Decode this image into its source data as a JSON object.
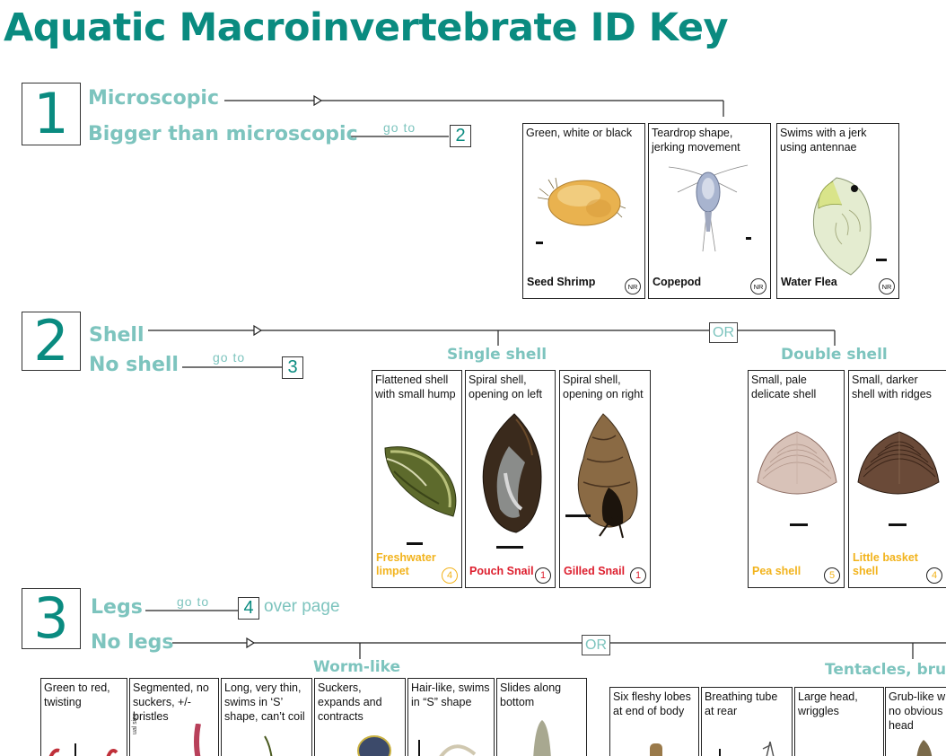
{
  "title": "Aquatic Macroinvertebrate ID Key",
  "steps": {
    "s1": {
      "number": "1",
      "opt_a": "Microscopic",
      "opt_b": "Bigger than microscopic",
      "goto_text": "go to",
      "goto_num": "2"
    },
    "s2": {
      "number": "2",
      "opt_a": "Shell",
      "opt_b": "No shell",
      "goto_text": "go to",
      "goto_num": "3",
      "or_label": "OR",
      "group_a": "Single shell",
      "group_b": "Double shell"
    },
    "s3": {
      "number": "3",
      "opt_a": "Legs",
      "opt_b": "No legs",
      "goto_text": "go to",
      "goto_num": "4",
      "over_page": "over page",
      "or_label": "OR",
      "group_a": "Worm-like",
      "group_b": "Tentacles, brus"
    }
  },
  "cards": {
    "seed_shrimp": {
      "desc": "Green, white or black",
      "name": "Seed Shrimp",
      "badge": "NR"
    },
    "copepod": {
      "desc": "Teardrop shape, jerking movement",
      "name": "Copepod",
      "badge": "NR"
    },
    "water_flea": {
      "desc": "Swims with a jerk using antennae",
      "name": "Water Flea",
      "badge": "NR"
    },
    "limpet": {
      "desc": "Flattened shell with small hump",
      "name": "Freshwater limpet",
      "badge": "4"
    },
    "pouch_snail": {
      "desc": "Spiral shell, opening on left",
      "name": "Pouch Snail",
      "badge": "1"
    },
    "gilled_snail": {
      "desc": "Spiral shell, opening on right",
      "name": "Gilled Snail",
      "badge": "1"
    },
    "pea_shell": {
      "desc": "Small, pale delicate shell",
      "name": "Pea shell",
      "badge": "5"
    },
    "basket_shell": {
      "desc": "Small, darker shell with ridges",
      "name": "Little basket shell",
      "badge": "4"
    },
    "w1": {
      "desc": "Green to red, twisting"
    },
    "w2": {
      "desc": "Segmented, no suckers, +/- bristles",
      "side_label": "ual size"
    },
    "w3": {
      "desc": "Long, very thin, swims in ‘S’ shape, can’t coil"
    },
    "w4": {
      "desc": "Suckers, expands and contracts"
    },
    "w5": {
      "desc": "Hair-like, swims in “S” shape"
    },
    "w6": {
      "desc": "Slides along bottom"
    },
    "t1": {
      "desc": "Six fleshy lobes at end of body"
    },
    "t2": {
      "desc": "Breathing tube at rear"
    },
    "t3": {
      "desc": "Large head, wriggles"
    },
    "t4": {
      "desc": "Grub-like w no obvious head"
    }
  },
  "colors": {
    "title": "#0a8b80",
    "option": "#7dc4be",
    "yellow": "#f2b31c",
    "red": "#dd1e2d"
  }
}
